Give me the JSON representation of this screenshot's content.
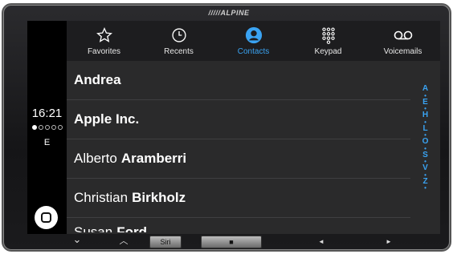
{
  "device": {
    "brand": "/////ALPINE"
  },
  "status": {
    "time": "16:21",
    "signal_bars": 1,
    "signal_total": 5,
    "network": "E"
  },
  "tabs": [
    {
      "label": "Favorites",
      "icon": "star-icon",
      "active": false
    },
    {
      "label": "Recents",
      "icon": "clock-icon",
      "active": false
    },
    {
      "label": "Contacts",
      "icon": "person-icon",
      "active": true
    },
    {
      "label": "Keypad",
      "icon": "keypad-icon",
      "active": false
    },
    {
      "label": "Voicemails",
      "icon": "voicemail-icon",
      "active": false
    }
  ],
  "contacts": [
    {
      "first": "Andrea",
      "last": ""
    },
    {
      "first": "Apple Inc.",
      "last": ""
    },
    {
      "first": "Alberto",
      "last": "Aramberri"
    },
    {
      "first": "Christian",
      "last": "Birkholz"
    },
    {
      "first": "Susan",
      "last": "Ford"
    }
  ],
  "index_letters": [
    "A",
    "•",
    "E",
    "•",
    "H",
    "•",
    "L",
    "•",
    "O",
    "•",
    "S",
    "•",
    "V",
    "•",
    "Z",
    "•"
  ],
  "hardware": {
    "up": "⌄",
    "down": "︿",
    "siri": "Siri",
    "stop": "■",
    "prev": "◄",
    "next": "►"
  },
  "colors": {
    "accent": "#3aa3f2",
    "list_bg": "#2a2a2b",
    "tab_bg": "#1d1d1f"
  }
}
